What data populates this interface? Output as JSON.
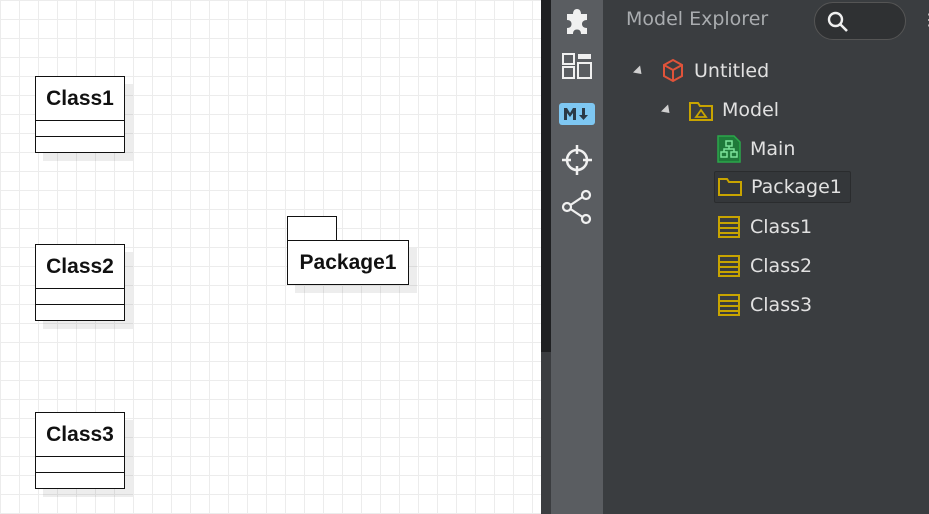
{
  "diagram": {
    "classes": [
      {
        "name": "Class1"
      },
      {
        "name": "Class2"
      },
      {
        "name": "Class3"
      }
    ],
    "package": {
      "name": "Package1"
    }
  },
  "sidebar_tools": [
    "extensions-icon",
    "layout-panels-icon",
    "markdown-icon",
    "crosshair-icon",
    "share-icon"
  ],
  "explorer": {
    "title": "Model Explorer",
    "search_placeholder": "",
    "tree": {
      "project": "Untitled",
      "model": "Model",
      "items": [
        "Main",
        "Package1",
        "Class1",
        "Class2",
        "Class3"
      ],
      "selected": "Package1"
    }
  },
  "colors": {
    "canvas_bg": "#ffffff",
    "grid": "#ececec",
    "explorer_bg": "#3a3d40",
    "toolbar_bg": "#5a5d61",
    "project_icon": "#e0533a",
    "folder_icon": "#c8a400",
    "diagram_icon": "#2aa84a",
    "markdown_icon": "#7ec7f2"
  }
}
